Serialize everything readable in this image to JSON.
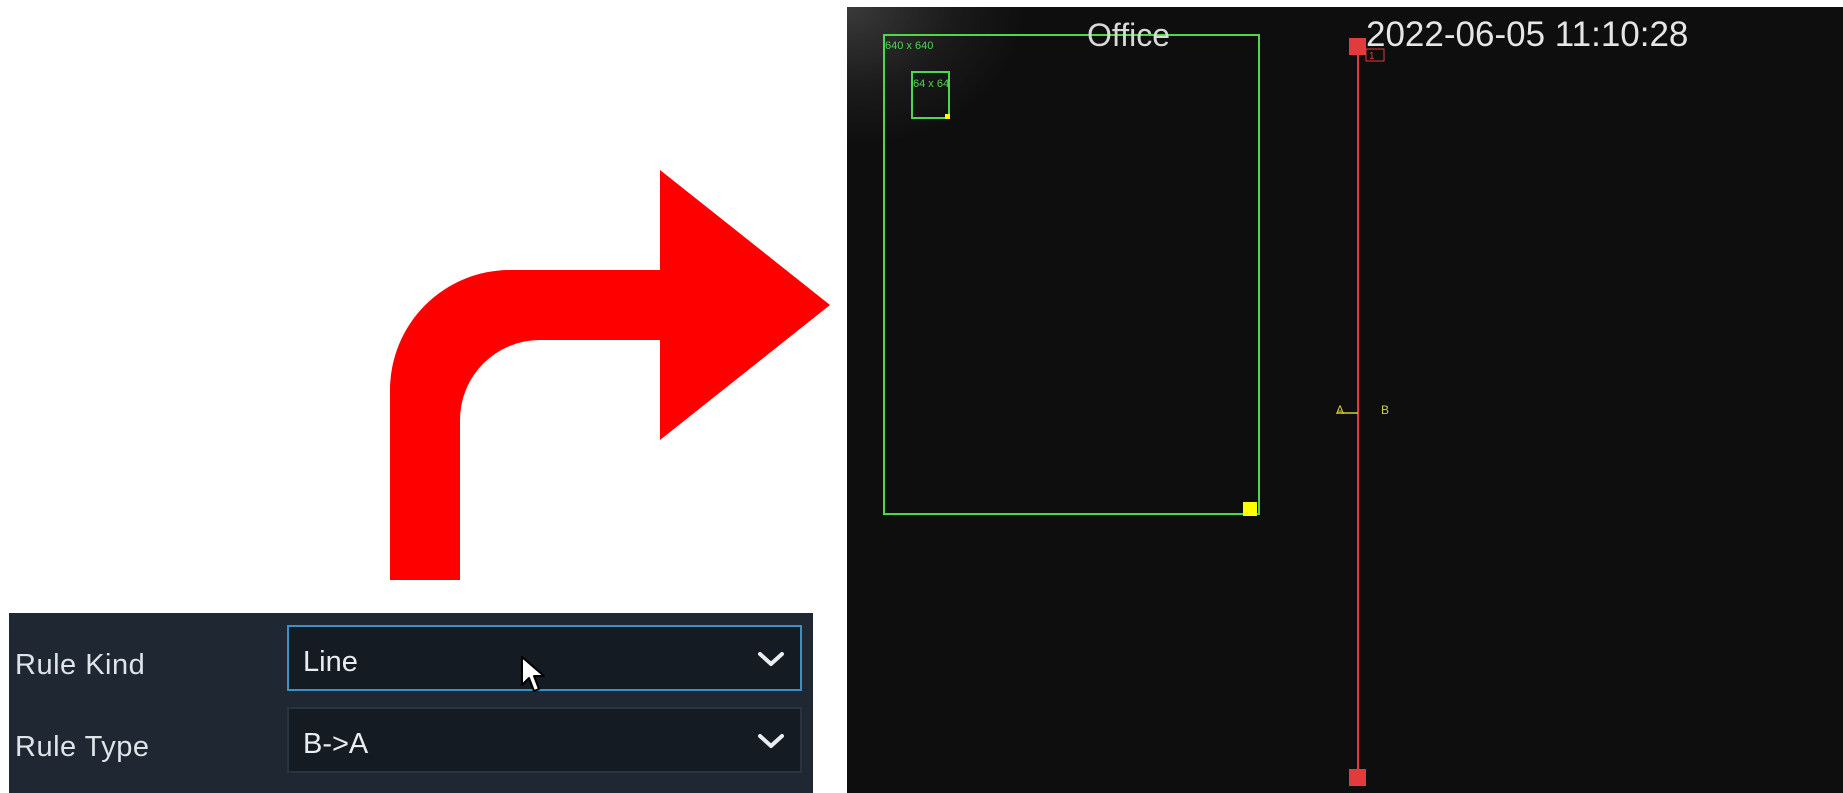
{
  "panel": {
    "rows": [
      {
        "label": "Rule Kind",
        "value": "Line"
      },
      {
        "label": "Rule Type",
        "value": "B->A"
      }
    ]
  },
  "camera": {
    "channel_name": "Office",
    "timestamp": "2022-06-05 11:10:28",
    "outer_box_size": "640 x 640",
    "inner_box_size": "64 x 64",
    "side_a": "A",
    "side_b": "B",
    "line_id": "1"
  },
  "colors": {
    "arrow": "#ff0000",
    "detection_box": "#4ed64e",
    "tripwire": "#e23b3b",
    "handle": "#ffff00",
    "focus_border": "#3d8fc4"
  },
  "icons": [
    "curved-arrow-icon",
    "chevron-down-icon",
    "mouse-cursor-icon"
  ]
}
